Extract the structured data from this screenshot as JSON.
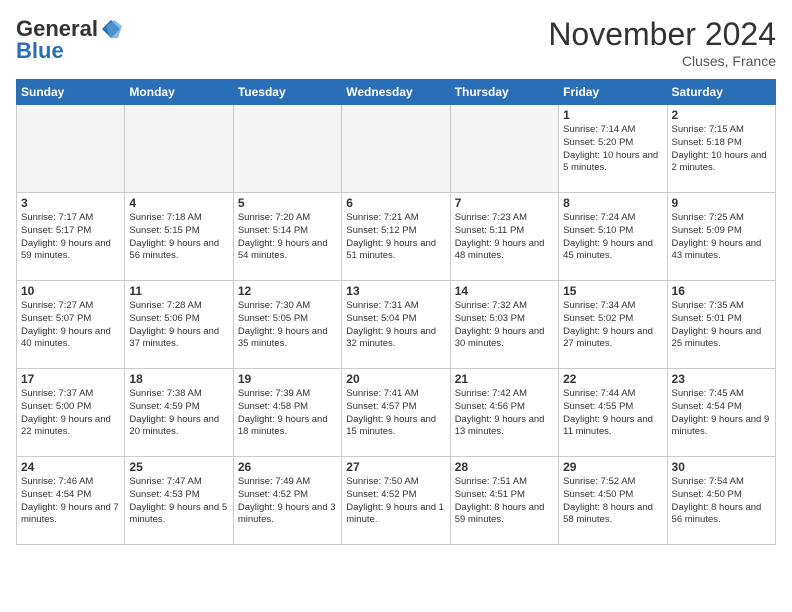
{
  "header": {
    "logo_general": "General",
    "logo_blue": "Blue",
    "month_title": "November 2024",
    "location": "Cluses, France"
  },
  "weekdays": [
    "Sunday",
    "Monday",
    "Tuesday",
    "Wednesday",
    "Thursday",
    "Friday",
    "Saturday"
  ],
  "weeks": [
    [
      {
        "day": "",
        "info": ""
      },
      {
        "day": "",
        "info": ""
      },
      {
        "day": "",
        "info": ""
      },
      {
        "day": "",
        "info": ""
      },
      {
        "day": "",
        "info": ""
      },
      {
        "day": "1",
        "info": "Sunrise: 7:14 AM\nSunset: 5:20 PM\nDaylight: 10 hours\nand 5 minutes."
      },
      {
        "day": "2",
        "info": "Sunrise: 7:15 AM\nSunset: 5:18 PM\nDaylight: 10 hours\nand 2 minutes."
      }
    ],
    [
      {
        "day": "3",
        "info": "Sunrise: 7:17 AM\nSunset: 5:17 PM\nDaylight: 9 hours\nand 59 minutes."
      },
      {
        "day": "4",
        "info": "Sunrise: 7:18 AM\nSunset: 5:15 PM\nDaylight: 9 hours\nand 56 minutes."
      },
      {
        "day": "5",
        "info": "Sunrise: 7:20 AM\nSunset: 5:14 PM\nDaylight: 9 hours\nand 54 minutes."
      },
      {
        "day": "6",
        "info": "Sunrise: 7:21 AM\nSunset: 5:12 PM\nDaylight: 9 hours\nand 51 minutes."
      },
      {
        "day": "7",
        "info": "Sunrise: 7:23 AM\nSunset: 5:11 PM\nDaylight: 9 hours\nand 48 minutes."
      },
      {
        "day": "8",
        "info": "Sunrise: 7:24 AM\nSunset: 5:10 PM\nDaylight: 9 hours\nand 45 minutes."
      },
      {
        "day": "9",
        "info": "Sunrise: 7:25 AM\nSunset: 5:09 PM\nDaylight: 9 hours\nand 43 minutes."
      }
    ],
    [
      {
        "day": "10",
        "info": "Sunrise: 7:27 AM\nSunset: 5:07 PM\nDaylight: 9 hours\nand 40 minutes."
      },
      {
        "day": "11",
        "info": "Sunrise: 7:28 AM\nSunset: 5:06 PM\nDaylight: 9 hours\nand 37 minutes."
      },
      {
        "day": "12",
        "info": "Sunrise: 7:30 AM\nSunset: 5:05 PM\nDaylight: 9 hours\nand 35 minutes."
      },
      {
        "day": "13",
        "info": "Sunrise: 7:31 AM\nSunset: 5:04 PM\nDaylight: 9 hours\nand 32 minutes."
      },
      {
        "day": "14",
        "info": "Sunrise: 7:32 AM\nSunset: 5:03 PM\nDaylight: 9 hours\nand 30 minutes."
      },
      {
        "day": "15",
        "info": "Sunrise: 7:34 AM\nSunset: 5:02 PM\nDaylight: 9 hours\nand 27 minutes."
      },
      {
        "day": "16",
        "info": "Sunrise: 7:35 AM\nSunset: 5:01 PM\nDaylight: 9 hours\nand 25 minutes."
      }
    ],
    [
      {
        "day": "17",
        "info": "Sunrise: 7:37 AM\nSunset: 5:00 PM\nDaylight: 9 hours\nand 22 minutes."
      },
      {
        "day": "18",
        "info": "Sunrise: 7:38 AM\nSunset: 4:59 PM\nDaylight: 9 hours\nand 20 minutes."
      },
      {
        "day": "19",
        "info": "Sunrise: 7:39 AM\nSunset: 4:58 PM\nDaylight: 9 hours\nand 18 minutes."
      },
      {
        "day": "20",
        "info": "Sunrise: 7:41 AM\nSunset: 4:57 PM\nDaylight: 9 hours\nand 15 minutes."
      },
      {
        "day": "21",
        "info": "Sunrise: 7:42 AM\nSunset: 4:56 PM\nDaylight: 9 hours\nand 13 minutes."
      },
      {
        "day": "22",
        "info": "Sunrise: 7:44 AM\nSunset: 4:55 PM\nDaylight: 9 hours\nand 11 minutes."
      },
      {
        "day": "23",
        "info": "Sunrise: 7:45 AM\nSunset: 4:54 PM\nDaylight: 9 hours\nand 9 minutes."
      }
    ],
    [
      {
        "day": "24",
        "info": "Sunrise: 7:46 AM\nSunset: 4:54 PM\nDaylight: 9 hours\nand 7 minutes."
      },
      {
        "day": "25",
        "info": "Sunrise: 7:47 AM\nSunset: 4:53 PM\nDaylight: 9 hours\nand 5 minutes."
      },
      {
        "day": "26",
        "info": "Sunrise: 7:49 AM\nSunset: 4:52 PM\nDaylight: 9 hours\nand 3 minutes."
      },
      {
        "day": "27",
        "info": "Sunrise: 7:50 AM\nSunset: 4:52 PM\nDaylight: 9 hours\nand 1 minute."
      },
      {
        "day": "28",
        "info": "Sunrise: 7:51 AM\nSunset: 4:51 PM\nDaylight: 8 hours\nand 59 minutes."
      },
      {
        "day": "29",
        "info": "Sunrise: 7:52 AM\nSunset: 4:50 PM\nDaylight: 8 hours\nand 58 minutes."
      },
      {
        "day": "30",
        "info": "Sunrise: 7:54 AM\nSunset: 4:50 PM\nDaylight: 8 hours\nand 56 minutes."
      }
    ]
  ]
}
